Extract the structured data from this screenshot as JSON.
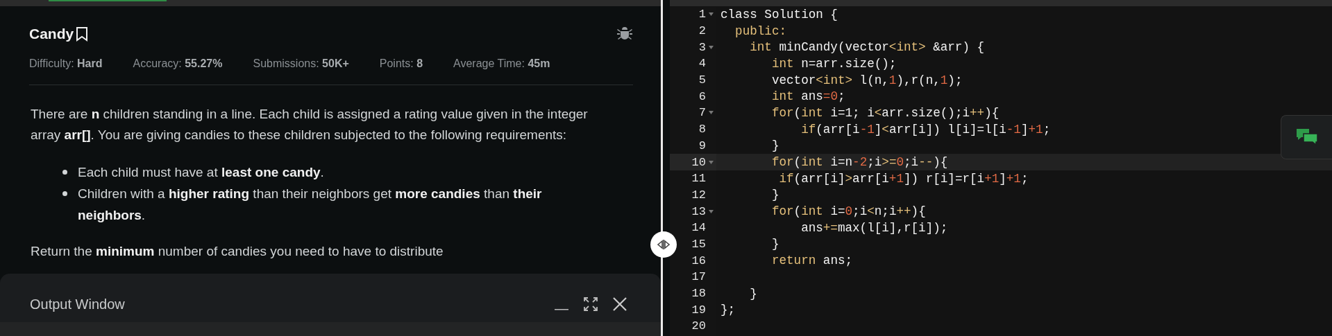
{
  "problem": {
    "title": "Candy",
    "progress": {
      "level": 0.2
    },
    "meta": [
      {
        "label": "Difficulty:",
        "value": "Hard"
      },
      {
        "label": "Accuracy:",
        "value": "55.27%"
      },
      {
        "label": "Submissions:",
        "value": "50K+"
      },
      {
        "label": "Points:",
        "value": "8"
      },
      {
        "label": "Average Time:",
        "value": "45m"
      }
    ],
    "paragraphs": [
      "There are **n** children standing in a line. Each child is assigned a rating value given in the integer array **arr[]**. You are giving candies to these children subjected to the following requirements:"
    ],
    "bullets": [
      "Each child must have at **least one candy**.",
      "Children with a **higher rating** than their neighbors get **more candies** than **their neighbors**."
    ],
    "closing": "Return the **minimum** number of candies you need to have to distribute"
  },
  "output_window": {
    "title": "Output Window"
  },
  "editor": {
    "lines": [
      {
        "number": "1",
        "fold": true,
        "active": false,
        "tokens": [
          {
            "kind": "plain",
            "text": "class Solution {"
          }
        ]
      },
      {
        "number": "2",
        "fold": false,
        "active": false,
        "tokens": [
          {
            "kind": "keyword",
            "text": "  public:"
          }
        ]
      },
      {
        "number": "3",
        "fold": true,
        "active": false,
        "tokens": [
          {
            "kind": "keyword",
            "text": "    int"
          },
          {
            "kind": "plain",
            "text": " minCandy(vector"
          },
          {
            "kind": "keyword",
            "text": "<int>"
          },
          {
            "kind": "plain",
            "text": " &arr) {"
          }
        ]
      },
      {
        "number": "4",
        "fold": false,
        "active": false,
        "tokens": [
          {
            "kind": "keyword",
            "text": "       int"
          },
          {
            "kind": "plain",
            "text": " n=arr.size();"
          }
        ]
      },
      {
        "number": "5",
        "fold": false,
        "active": false,
        "tokens": [
          {
            "kind": "plain",
            "text": "       vector"
          },
          {
            "kind": "keyword",
            "text": "<int>"
          },
          {
            "kind": "plain",
            "text": " l(n,"
          },
          {
            "kind": "number",
            "text": "1"
          },
          {
            "kind": "plain",
            "text": "),r(n,"
          },
          {
            "kind": "number",
            "text": "1"
          },
          {
            "kind": "plain",
            "text": ");"
          }
        ]
      },
      {
        "number": "6",
        "fold": false,
        "active": false,
        "tokens": [
          {
            "kind": "keyword",
            "text": "       int"
          },
          {
            "kind": "plain",
            "text": " ans"
          },
          {
            "kind": "number",
            "text": "=0"
          },
          {
            "kind": "plain",
            "text": ";"
          }
        ]
      },
      {
        "number": "7",
        "fold": true,
        "active": false,
        "tokens": [
          {
            "kind": "keyword",
            "text": "       for"
          },
          {
            "kind": "plain",
            "text": "("
          },
          {
            "kind": "keyword",
            "text": "int"
          },
          {
            "kind": "plain",
            "text": " i=1; i"
          },
          {
            "kind": "keyword",
            "text": "<"
          },
          {
            "kind": "plain",
            "text": "arr.size();i"
          },
          {
            "kind": "keyword",
            "text": "++"
          },
          {
            "kind": "plain",
            "text": "){"
          }
        ]
      },
      {
        "number": "8",
        "fold": false,
        "active": false,
        "tokens": [
          {
            "kind": "keyword",
            "text": "           if"
          },
          {
            "kind": "plain",
            "text": "(arr[i"
          },
          {
            "kind": "number",
            "text": "-1"
          },
          {
            "kind": "plain",
            "text": "]"
          },
          {
            "kind": "keyword",
            "text": "<"
          },
          {
            "kind": "plain",
            "text": "arr[i]) l[i]=l[i"
          },
          {
            "kind": "number",
            "text": "-1"
          },
          {
            "kind": "plain",
            "text": "]"
          },
          {
            "kind": "number",
            "text": "+1"
          },
          {
            "kind": "plain",
            "text": ";"
          }
        ]
      },
      {
        "number": "9",
        "fold": false,
        "active": false,
        "tokens": [
          {
            "kind": "plain",
            "text": "       }"
          }
        ]
      },
      {
        "number": "10",
        "fold": true,
        "active": true,
        "tokens": [
          {
            "kind": "keyword",
            "text": "       for"
          },
          {
            "kind": "plain",
            "text": "("
          },
          {
            "kind": "keyword",
            "text": "int"
          },
          {
            "kind": "plain",
            "text": " i=n"
          },
          {
            "kind": "number",
            "text": "-2"
          },
          {
            "kind": "plain",
            "text": ";i"
          },
          {
            "kind": "keyword",
            "text": ">="
          },
          {
            "kind": "number",
            "text": "0"
          },
          {
            "kind": "plain",
            "text": ";i"
          },
          {
            "kind": "keyword",
            "text": "--"
          },
          {
            "kind": "plain",
            "text": "){"
          }
        ]
      },
      {
        "number": "11",
        "fold": false,
        "active": false,
        "tokens": [
          {
            "kind": "keyword",
            "text": "        if"
          },
          {
            "kind": "plain",
            "text": "(arr[i]"
          },
          {
            "kind": "keyword",
            "text": ">"
          },
          {
            "kind": "plain",
            "text": "arr[i"
          },
          {
            "kind": "number",
            "text": "+1"
          },
          {
            "kind": "plain",
            "text": "]) r[i]=r[i"
          },
          {
            "kind": "number",
            "text": "+1"
          },
          {
            "kind": "plain",
            "text": "]"
          },
          {
            "kind": "number",
            "text": "+1"
          },
          {
            "kind": "plain",
            "text": ";"
          }
        ]
      },
      {
        "number": "12",
        "fold": false,
        "active": false,
        "tokens": [
          {
            "kind": "plain",
            "text": "       }"
          }
        ]
      },
      {
        "number": "13",
        "fold": true,
        "active": false,
        "tokens": [
          {
            "kind": "keyword",
            "text": "       for"
          },
          {
            "kind": "plain",
            "text": "("
          },
          {
            "kind": "keyword",
            "text": "int"
          },
          {
            "kind": "plain",
            "text": " i="
          },
          {
            "kind": "number",
            "text": "0"
          },
          {
            "kind": "plain",
            "text": ";i"
          },
          {
            "kind": "keyword",
            "text": "<"
          },
          {
            "kind": "plain",
            "text": "n;i"
          },
          {
            "kind": "keyword",
            "text": "++"
          },
          {
            "kind": "plain",
            "text": "){"
          }
        ]
      },
      {
        "number": "14",
        "fold": false,
        "active": false,
        "tokens": [
          {
            "kind": "plain",
            "text": "           ans"
          },
          {
            "kind": "keyword",
            "text": "+="
          },
          {
            "kind": "plain",
            "text": "max(l[i],r[i]);"
          }
        ]
      },
      {
        "number": "15",
        "fold": false,
        "active": false,
        "tokens": [
          {
            "kind": "plain",
            "text": "       }"
          }
        ]
      },
      {
        "number": "16",
        "fold": false,
        "active": false,
        "tokens": [
          {
            "kind": "keyword",
            "text": "       return"
          },
          {
            "kind": "plain",
            "text": " ans;"
          }
        ]
      },
      {
        "number": "17",
        "fold": false,
        "active": false
      },
      {
        "number": "18",
        "fold": false,
        "active": false,
        "tokens": [
          {
            "kind": "plain",
            "text": "    }"
          }
        ]
      },
      {
        "number": "19",
        "fold": false,
        "active": false,
        "tokens": [
          {
            "kind": "plain",
            "text": "};"
          }
        ]
      },
      {
        "number": "20",
        "fold": false,
        "active": false
      }
    ]
  }
}
